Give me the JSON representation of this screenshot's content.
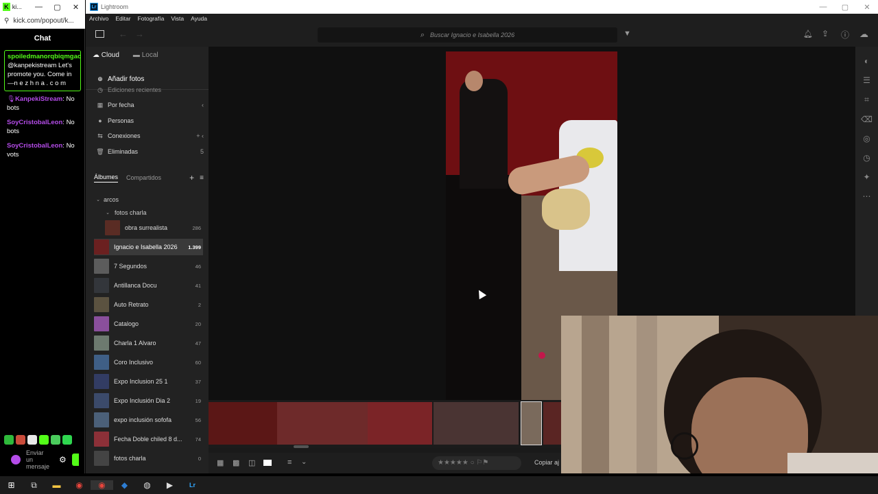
{
  "chat_window": {
    "title": "ki...",
    "url": "kick.com/popout/k...",
    "header": "Chat",
    "pinned": {
      "user": "spoiledmanorqbiqmgaohq",
      "text": ": @kanpekistream Let's promote you. Come in —n e z h n a . c o m"
    },
    "messages": [
      {
        "user": "KanpekiStream",
        "text": ": No bots",
        "color": "#b44ce8"
      },
      {
        "user": "SoyCristobalLeon",
        "text": ": No bots",
        "color": "#b44ce8"
      },
      {
        "user": "SoyCristobalLeon",
        "text": ": No vots",
        "color": "#b44ce8"
      }
    ],
    "input_placeholder": "Enviar un mensaje",
    "accent": "#53fc18"
  },
  "lightroom": {
    "title": "Lightroom",
    "menu": [
      "Archivo",
      "Editar",
      "Fotografía",
      "Vista",
      "Ayuda"
    ],
    "search_placeholder": "Buscar  Ignacio e Isabella 2026",
    "tab_cloud": "Cloud",
    "tab_local": "Local",
    "add_photos": "Añadir fotos",
    "recent_edits": "Ediciones recientes",
    "nav": [
      {
        "label": "Por fecha",
        "trail": "‹"
      },
      {
        "label": "Personas",
        "trail": ""
      },
      {
        "label": "Conexiones",
        "trail": "+  ‹"
      },
      {
        "label": "Eliminadas",
        "trail": "5"
      }
    ],
    "albums_tab": "Álbumes",
    "shared_tab": "Compartidos",
    "folder_arcos": "arcos",
    "folder_fotos_charla": "fotos charla",
    "albums": [
      {
        "name": "obra surrealista",
        "count": "286",
        "thumb": "#5a2c24"
      },
      {
        "name": "Ignacio e Isabella 2026",
        "count": "1.399",
        "thumb": "#6b2020",
        "selected": true
      },
      {
        "name": "7 Segundos",
        "count": "46",
        "thumb": "#5c5c5c"
      },
      {
        "name": "Antillanca Docu",
        "count": "41",
        "thumb": "#33363b"
      },
      {
        "name": "Auto Retrato",
        "count": "2",
        "thumb": "#5b5240"
      },
      {
        "name": "Catalogo",
        "count": "20",
        "thumb": "#8a4f9c"
      },
      {
        "name": "Charla 1 Alvaro",
        "count": "47",
        "thumb": "#6d7a6f"
      },
      {
        "name": "Coro Inclusivo",
        "count": "60",
        "thumb": "#3f5f86"
      },
      {
        "name": "Expo Inclusion  25 1",
        "count": "37",
        "thumb": "#323c63"
      },
      {
        "name": "Expo Inclusión Dia 2",
        "count": "19",
        "thumb": "#3b4a6a"
      },
      {
        "name": "expo inclusión sofofa",
        "count": "56",
        "thumb": "#4b6079"
      },
      {
        "name": "Fecha Doble chiled 8 d...",
        "count": "74",
        "thumb": "#8c3038"
      },
      {
        "name": "fotos charla",
        "count": "0",
        "thumb": "#444"
      }
    ],
    "copy_label": "Copiar aj"
  },
  "taskbar_icons": [
    "windows-icon",
    "search-icon",
    "task-view-icon",
    "file-explorer-icon",
    "chrome-icon",
    "chrome-icon",
    "app-icon",
    "obs-icon",
    "media-player-icon",
    "lightroom-icon"
  ]
}
